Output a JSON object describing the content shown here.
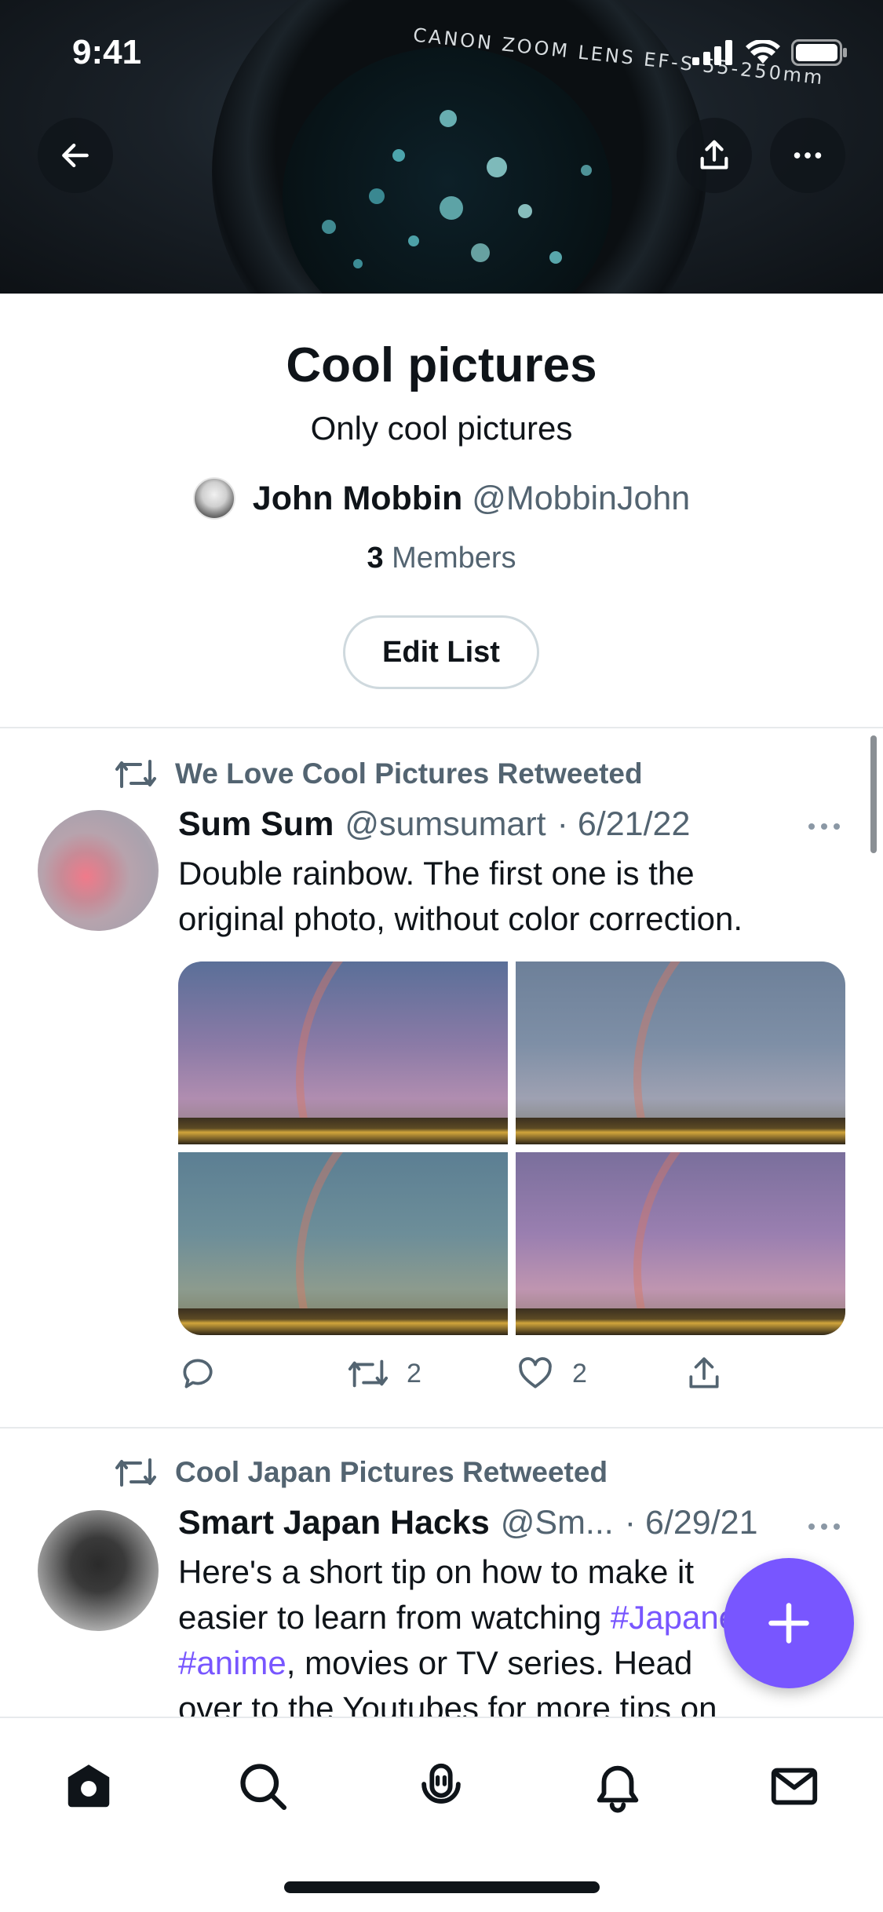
{
  "status_bar": {
    "time": "9:41"
  },
  "banner": {
    "lens_text_top": "CANON ZOOM LENS EF-S 55-250mm",
    "icons": {
      "back": "arrow-left-icon",
      "share": "share-icon",
      "more": "more-horizontal-icon"
    }
  },
  "list": {
    "title": "Cool pictures",
    "description": "Only cool pictures",
    "owner_name": "John Mobbin",
    "owner_handle": "@MobbinJohn",
    "members_count": "3",
    "members_label": "Members",
    "edit_button": "Edit List"
  },
  "tweets": [
    {
      "retweeted_by": "We Love Cool Pictures Retweeted",
      "name": "Sum Sum",
      "handle": "@sumsumart",
      "date": "· 6/21/22",
      "text_line1": "Double rainbow. The first one is the",
      "text_line2": "original photo, without color correction.",
      "retweets": "2",
      "likes": "2"
    },
    {
      "retweeted_by": "Cool Japan Pictures Retweeted",
      "name": "Smart Japan Hacks",
      "handle": "@Sm...",
      "date": "· 6/29/21",
      "text_line1": "Here's a  short tip on how to make it",
      "text_line2_pre": "easier to learn from watching ",
      "text_line2_tag": "#Japanese",
      "text_line3_tag": "#anime",
      "text_line3_post": ", movies or TV series. Head",
      "text_line4": "over to the Youtubes for more tips on"
    }
  ],
  "colors": {
    "accent": "#7856ff",
    "muted": "#536471",
    "text": "#0f1419"
  },
  "bottom_nav": [
    "home-icon",
    "search-icon",
    "spaces-icon",
    "notifications-icon",
    "messages-icon"
  ]
}
